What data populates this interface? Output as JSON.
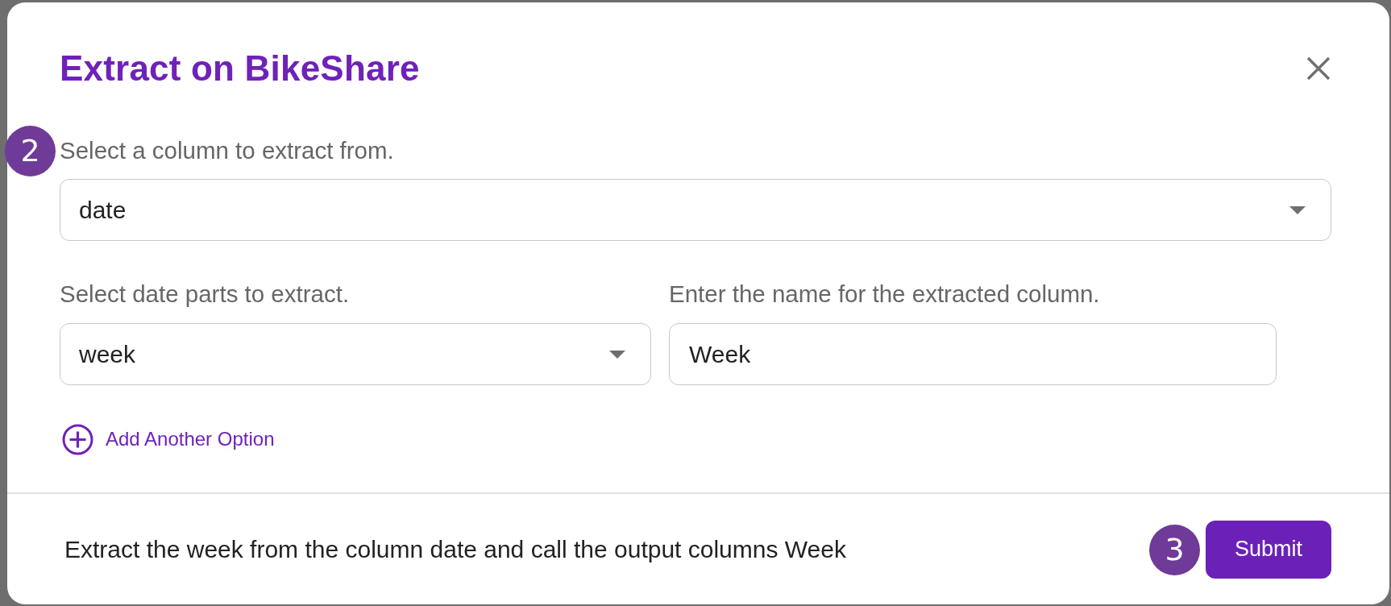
{
  "dialog": {
    "title": "Extract on BikeShare"
  },
  "rows": [
    {
      "fields": [
        {
          "kind": "select",
          "label": "Select a column to extract from.",
          "value": "date",
          "step_marker": "2"
        }
      ]
    },
    {
      "fields": [
        {
          "kind": "select",
          "label": "Select date parts to extract.",
          "value": "week"
        },
        {
          "kind": "text",
          "label": "Enter the name for the extracted column.",
          "value": "Week"
        }
      ]
    }
  ],
  "add_option": {
    "label": "Add Another Option"
  },
  "footer": {
    "summary": "Extract the week from the column date and call the output columns Week",
    "submit": {
      "label": "Submit",
      "step_marker": "3"
    }
  }
}
